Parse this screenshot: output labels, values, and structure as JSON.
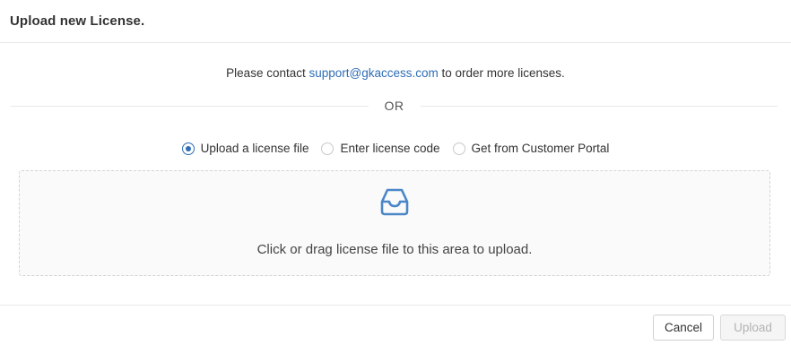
{
  "dialog": {
    "title": "Upload new License."
  },
  "contact": {
    "prefix": "Please contact ",
    "email": "support@gkaccess.com",
    "suffix": " to order more licenses."
  },
  "divider": {
    "text": "OR"
  },
  "source_options": [
    {
      "label": "Upload a license file",
      "selected": true
    },
    {
      "label": "Enter license code",
      "selected": false
    },
    {
      "label": "Get from Customer Portal",
      "selected": false
    }
  ],
  "drop_zone": {
    "icon": "inbox-icon",
    "text": "Click or drag license file to this area to upload."
  },
  "footer": {
    "cancel_label": "Cancel",
    "upload_label": "Upload",
    "upload_disabled": true
  },
  "colors": {
    "accent": "#2f6db5",
    "drop_icon": "#4a86c8"
  }
}
